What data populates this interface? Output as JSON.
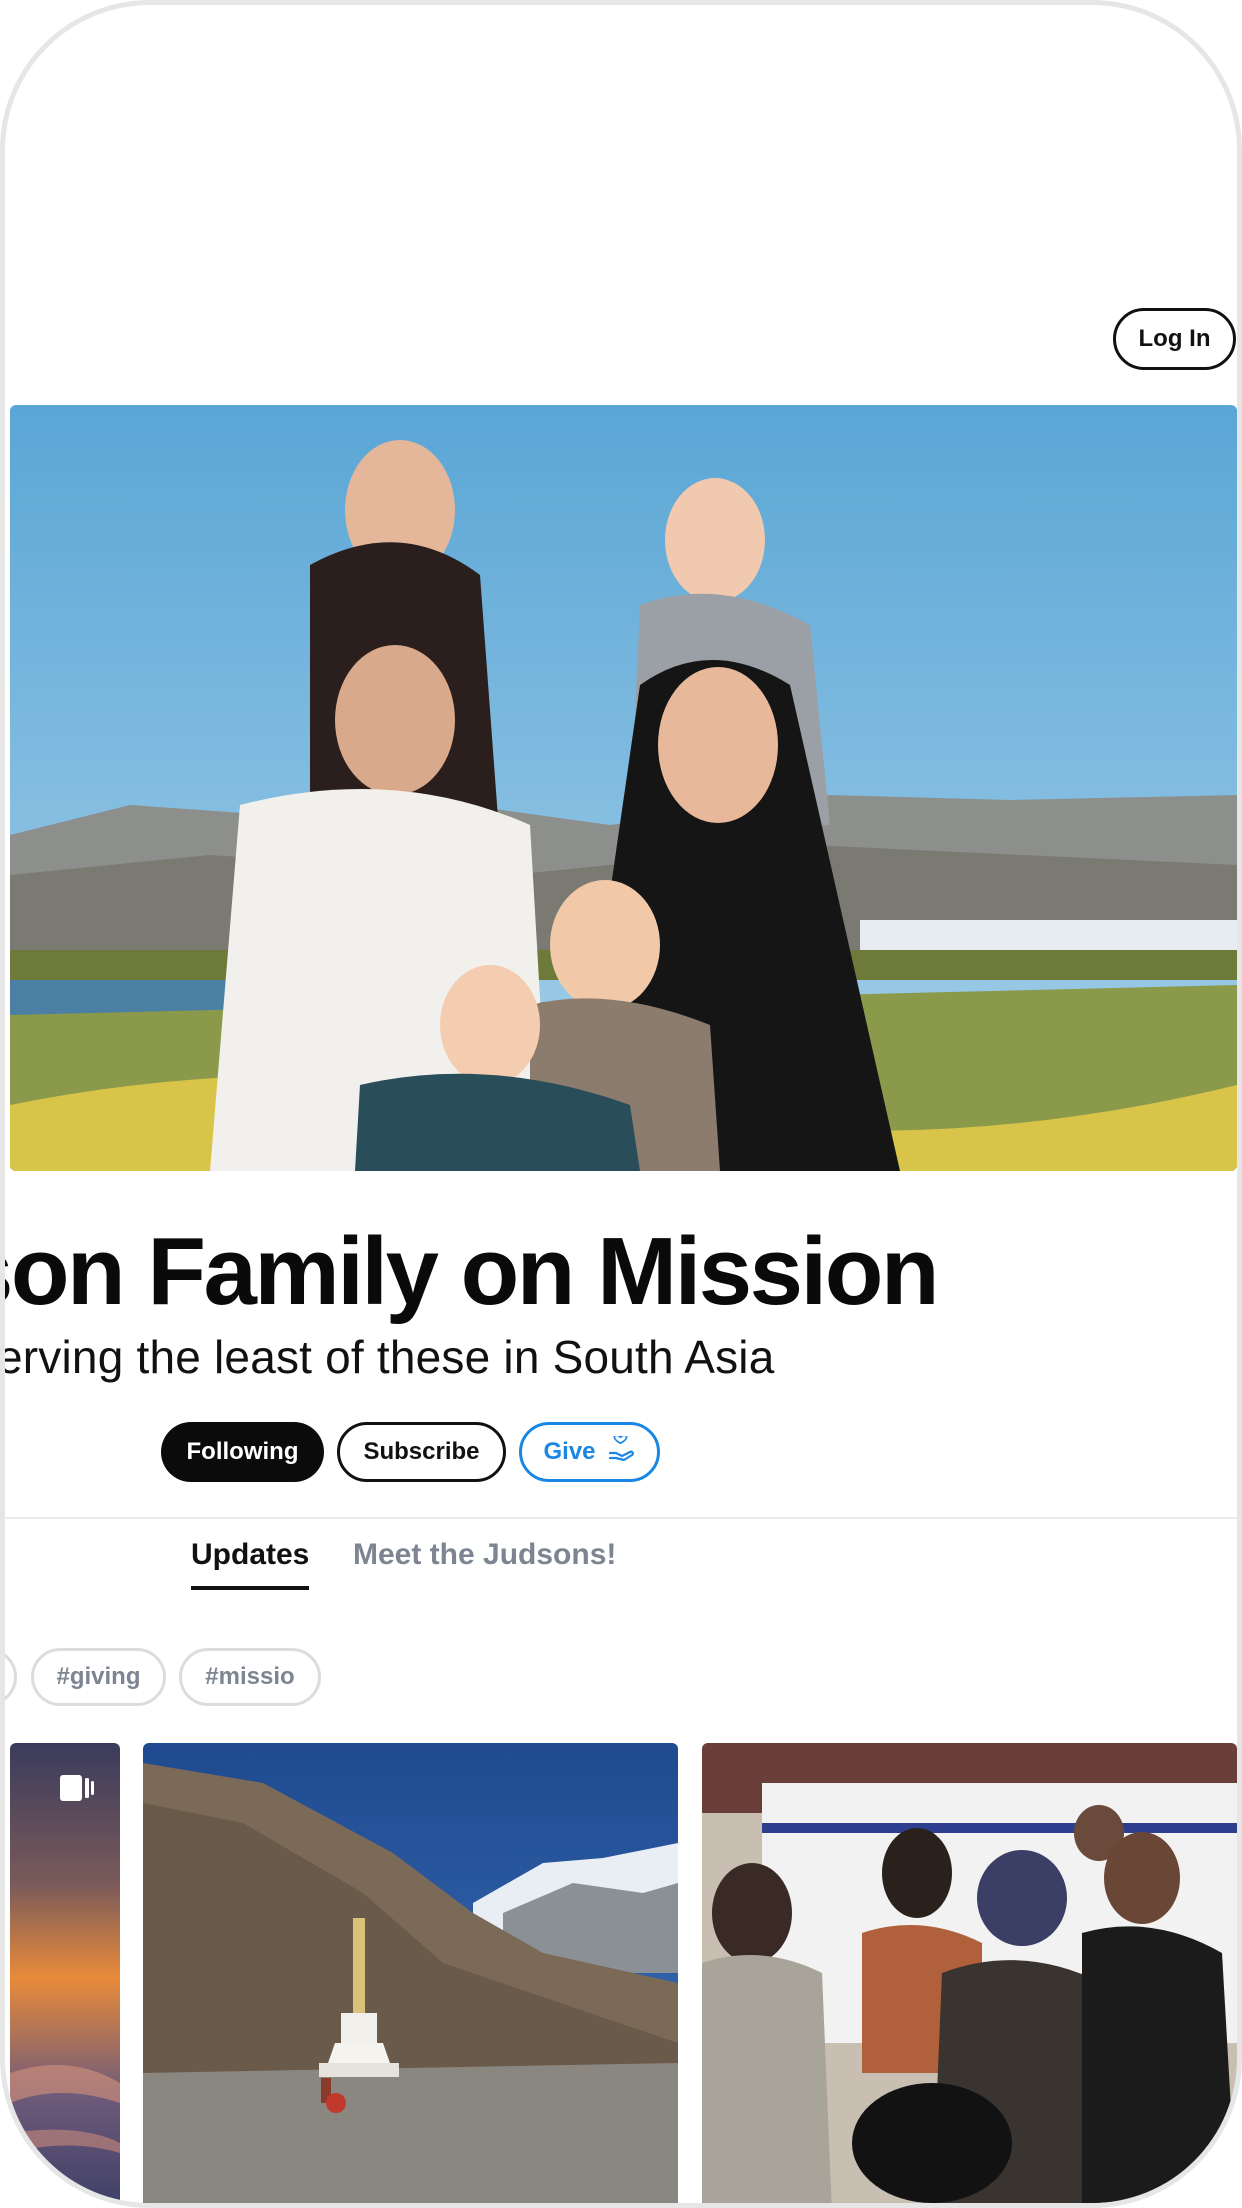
{
  "header": {
    "login_label": "Log In"
  },
  "profile": {
    "title": "son Family on Mission",
    "subtitle": "erving the least of these in South Asia"
  },
  "actions": {
    "following_label": "Following",
    "subscribe_label": "Subscribe",
    "give_label": "Give"
  },
  "tabs": [
    {
      "label": "Updates",
      "active": true
    },
    {
      "label": "Meet the Judsons!",
      "active": false
    }
  ],
  "tags": [
    "#giving",
    "#missio"
  ],
  "icons": {
    "give": "hand-heart-icon",
    "gallery": "multiple-images-icon"
  },
  "colors": {
    "accent_blue": "#1b87e5",
    "primary_black": "#0b0b0b",
    "muted_text": "#7d8592"
  }
}
